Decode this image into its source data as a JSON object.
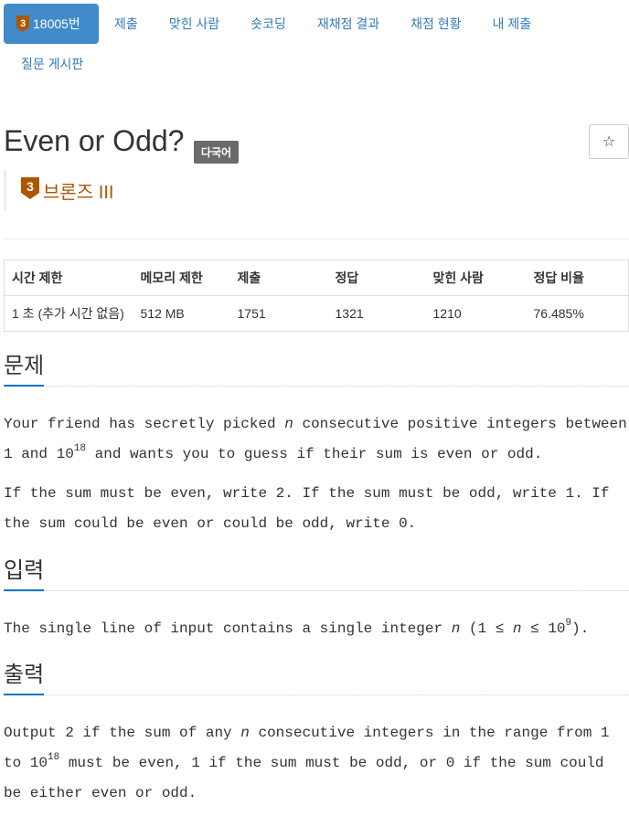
{
  "nav": {
    "active": {
      "tier": "3",
      "label": "18005번"
    },
    "items": [
      "제출",
      "맞힌 사람",
      "숏코딩",
      "재채점 결과",
      "채점 현황",
      "내 제출"
    ],
    "row2": [
      "질문 게시판"
    ]
  },
  "problem": {
    "title": "Even or Odd?",
    "lang_badge": "다국어",
    "star": "☆",
    "tier": {
      "level": "3",
      "label": "브론즈 III",
      "color": "#ad5600"
    }
  },
  "stats": {
    "headers": [
      "시간 제한",
      "메모리 제한",
      "제출",
      "정답",
      "맞힌 사람",
      "정답 비율"
    ],
    "values": [
      "1 초 (추가 시간 없음)",
      "512 MB",
      "1751",
      "1321",
      "1210",
      "76.485%"
    ]
  },
  "sections": {
    "problem_title": "문제",
    "input_title": "입력",
    "output_title": "출력"
  },
  "text": {
    "p1_a": "Your friend has secretly picked ",
    "n": "n",
    "p1_b": " consecutive positive integers between 1 and 10",
    "exp18": "18",
    "p1_c": " and wants you to guess if their sum is even or odd.",
    "p2": "If the sum must be even, write 2. If the sum must be odd, write 1. If the sum could be even or could be odd, write 0.",
    "in_a": "The single line of input contains a single integer ",
    "in_b": " (1 ≤ ",
    "in_c": " ≤ 10",
    "exp9": "9",
    "in_d": ").",
    "out_a": "Output 2 if the sum of any ",
    "out_b": " consecutive integers in the range from 1 to 10",
    "out_c": " must be even, 1 if the sum must be odd, or 0 if the sum could be either even or odd."
  },
  "colors": {
    "accent": "#428bca",
    "bronze": "#ad5600",
    "link": "#337ab7"
  }
}
